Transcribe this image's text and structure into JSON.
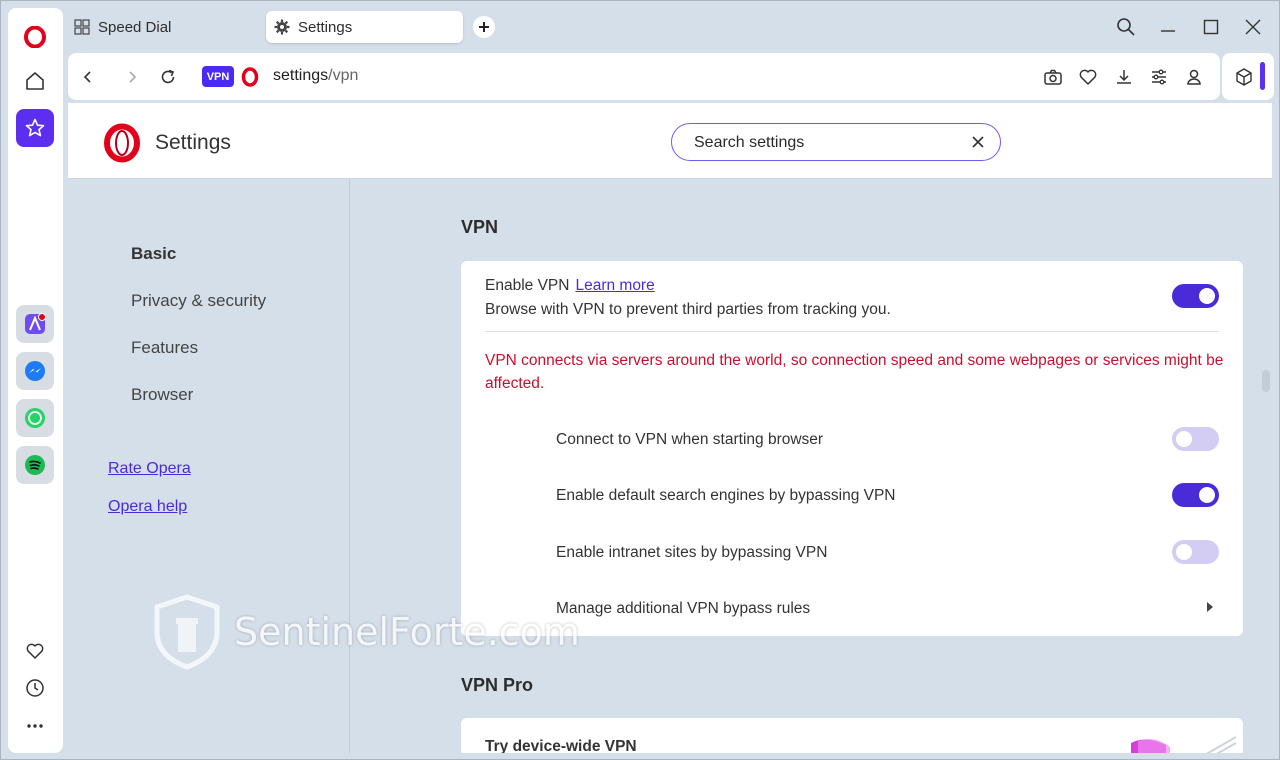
{
  "tabs": [
    {
      "label": "Speed Dial",
      "icon": "grid-icon"
    },
    {
      "label": "Settings",
      "icon": "gear-icon"
    }
  ],
  "address_bar": {
    "vpn_badge": "VPN",
    "url_host": "settings",
    "url_path": "/vpn"
  },
  "page": {
    "title": "Settings",
    "search_value": "Search settings"
  },
  "nav": {
    "items": [
      "Basic",
      "Privacy & security",
      "Features",
      "Browser"
    ],
    "active": "Basic",
    "links": [
      "Rate Opera",
      "Opera help"
    ]
  },
  "vpn_section": {
    "title": "VPN",
    "enable_label": "Enable VPN",
    "learn_more": "Learn more",
    "enable_desc": "Browse with VPN to prevent third parties from tracking you.",
    "enable_on": true,
    "warning": "VPN connects via servers around the world, so connection speed and some webpages or services might be affected.",
    "options": [
      {
        "label": "Connect to VPN when starting browser",
        "on": false
      },
      {
        "label": "Enable default search engines by bypassing VPN",
        "on": true
      },
      {
        "label": "Enable intranet sites by bypassing VPN",
        "on": false
      }
    ],
    "bypass_rules": "Manage additional VPN bypass rules"
  },
  "vpn_pro_section": {
    "title": "VPN Pro",
    "card_title": "Try device-wide VPN"
  },
  "watermark": "SentinelForte.com",
  "colors": {
    "accent": "#4a2bd8",
    "warning": "#c8102e",
    "opera_red": "#e2001a",
    "background": "#d5dfea"
  }
}
